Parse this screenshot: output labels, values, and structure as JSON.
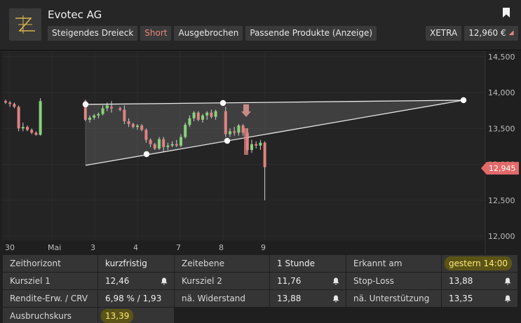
{
  "header": {
    "title": "Evotec AG",
    "tags": [
      "Steigendes Dreieck",
      "Short",
      "Ausgebrochen",
      "Passende Produkte (Anzeige)"
    ],
    "exchange": "XETRA",
    "price": "12,960 €",
    "icons": {
      "logo": "zignals-logo",
      "bookmark": "bookmark-icon",
      "price_dot": "triangle-marker-icon"
    },
    "colors": {
      "short": "#e8867e"
    }
  },
  "chart_data": {
    "type": "candlestick",
    "pattern": "Steigendes Dreieck",
    "y_ticks": [
      "14,500",
      "14,000",
      "13,500",
      "13,000",
      "12,500",
      "12,000"
    ],
    "y_tick_values": [
      14.5,
      14.0,
      13.5,
      13.0,
      12.5,
      12.0
    ],
    "ylim": [
      11.7,
      14.7
    ],
    "x_ticks": [
      "30",
      "Mai",
      "3",
      "4",
      "7",
      "8",
      "9"
    ],
    "current_price_label": "12,945",
    "current_price": 12.945,
    "colors": {
      "up": "#86d37a",
      "down": "#e08282",
      "price_marker": "#e36a6a",
      "line": "#e8e8e8"
    },
    "candles": [
      [
        13.88,
        13.9,
        13.84,
        13.86
      ],
      [
        13.86,
        13.88,
        13.8,
        13.84
      ],
      [
        13.84,
        13.86,
        13.78,
        13.8
      ],
      [
        13.8,
        13.82,
        13.46,
        13.5
      ],
      [
        13.5,
        13.58,
        13.46,
        13.52
      ],
      [
        13.52,
        13.54,
        13.46,
        13.48
      ],
      [
        13.48,
        13.5,
        13.42,
        13.44
      ],
      [
        13.44,
        13.46,
        13.4,
        13.41
      ],
      [
        13.41,
        13.92,
        13.4,
        13.88
      ],
      [
        13.88,
        13.9,
        13.6,
        13.62
      ],
      [
        13.62,
        13.68,
        13.58,
        13.65
      ],
      [
        13.65,
        13.7,
        13.62,
        13.68
      ],
      [
        13.68,
        13.72,
        13.64,
        13.7
      ],
      [
        13.7,
        13.82,
        13.68,
        13.78
      ],
      [
        13.78,
        13.86,
        13.74,
        13.82
      ],
      [
        13.8,
        13.88,
        13.72,
        13.78
      ],
      [
        13.78,
        13.8,
        13.74,
        13.76
      ],
      [
        13.76,
        13.82,
        13.56,
        13.6
      ],
      [
        13.6,
        13.64,
        13.52,
        13.56
      ],
      [
        13.56,
        13.58,
        13.5,
        13.52
      ],
      [
        13.52,
        13.56,
        13.48,
        13.54
      ],
      [
        13.54,
        13.56,
        13.46,
        13.48
      ],
      [
        13.48,
        13.5,
        13.3,
        13.34
      ],
      [
        13.34,
        13.36,
        13.24,
        13.28
      ],
      [
        13.28,
        13.3,
        13.2,
        13.22
      ],
      [
        13.22,
        13.38,
        13.2,
        13.35
      ],
      [
        13.35,
        13.38,
        13.18,
        13.24
      ],
      [
        13.24,
        13.3,
        13.2,
        13.26
      ],
      [
        13.26,
        13.32,
        13.24,
        13.28
      ],
      [
        13.28,
        13.34,
        13.24,
        13.26
      ],
      [
        13.26,
        13.42,
        13.24,
        13.38
      ],
      [
        13.38,
        13.58,
        13.36,
        13.55
      ],
      [
        13.55,
        13.68,
        13.52,
        13.64
      ],
      [
        13.64,
        13.74,
        13.6,
        13.72
      ],
      [
        13.72,
        13.74,
        13.6,
        13.62
      ],
      [
        13.62,
        13.7,
        13.58,
        13.68
      ],
      [
        13.68,
        13.74,
        13.62,
        13.72
      ],
      [
        13.72,
        13.76,
        13.64,
        13.66
      ],
      [
        13.66,
        13.76,
        13.62,
        13.74
      ],
      [
        13.74,
        13.8,
        13.38,
        13.42
      ],
      [
        13.42,
        13.5,
        13.38,
        13.46
      ],
      [
        13.46,
        13.52,
        13.4,
        13.44
      ],
      [
        13.44,
        13.56,
        13.4,
        13.54
      ],
      [
        13.54,
        13.56,
        13.4,
        13.44
      ],
      [
        13.44,
        13.5,
        13.18,
        13.2
      ],
      [
        13.2,
        13.34,
        13.16,
        13.28
      ],
      [
        13.28,
        13.32,
        13.22,
        13.26
      ],
      [
        13.26,
        13.34,
        13.2,
        13.3
      ],
      [
        13.3,
        13.32,
        12.5,
        12.96
      ]
    ],
    "triangle": {
      "upper": [
        [
          12,
          13.9
        ],
        [
          31,
          13.9
        ],
        [
          67,
          13.9
        ]
      ],
      "lower": [
        [
          12,
          12.96
        ],
        [
          21,
          13.18
        ],
        [
          33,
          13.36
        ],
        [
          67,
          13.9
        ]
      ]
    }
  },
  "info": {
    "rows": [
      [
        {
          "label": "Zeithorizont",
          "value": "kurzfristig"
        },
        {
          "label": "Zeitebene",
          "value": "1 Stunde"
        },
        {
          "label": "Erkannt am",
          "value": "gestern 14:00",
          "highlight": true
        }
      ],
      [
        {
          "label": "Kursziel 1",
          "value": "12,46",
          "bell": true
        },
        {
          "label": "Kursziel 2",
          "value": "11,76",
          "bell": true
        },
        {
          "label": "Stop-Loss",
          "value": "13,88",
          "bell": true
        }
      ],
      [
        {
          "label": "Rendite-Erw. / CRV",
          "value": "6,98 % / 1,93"
        },
        {
          "label": "nä. Widerstand",
          "value": "13,88",
          "bell": true
        },
        {
          "label": "nä. Unterstützung",
          "value": "13,35",
          "bell": true
        }
      ],
      [
        {
          "label": "Ausbruchskurs",
          "value": "13,39",
          "highlight": true
        }
      ]
    ],
    "icons": {
      "bell": "bell-icon"
    }
  }
}
